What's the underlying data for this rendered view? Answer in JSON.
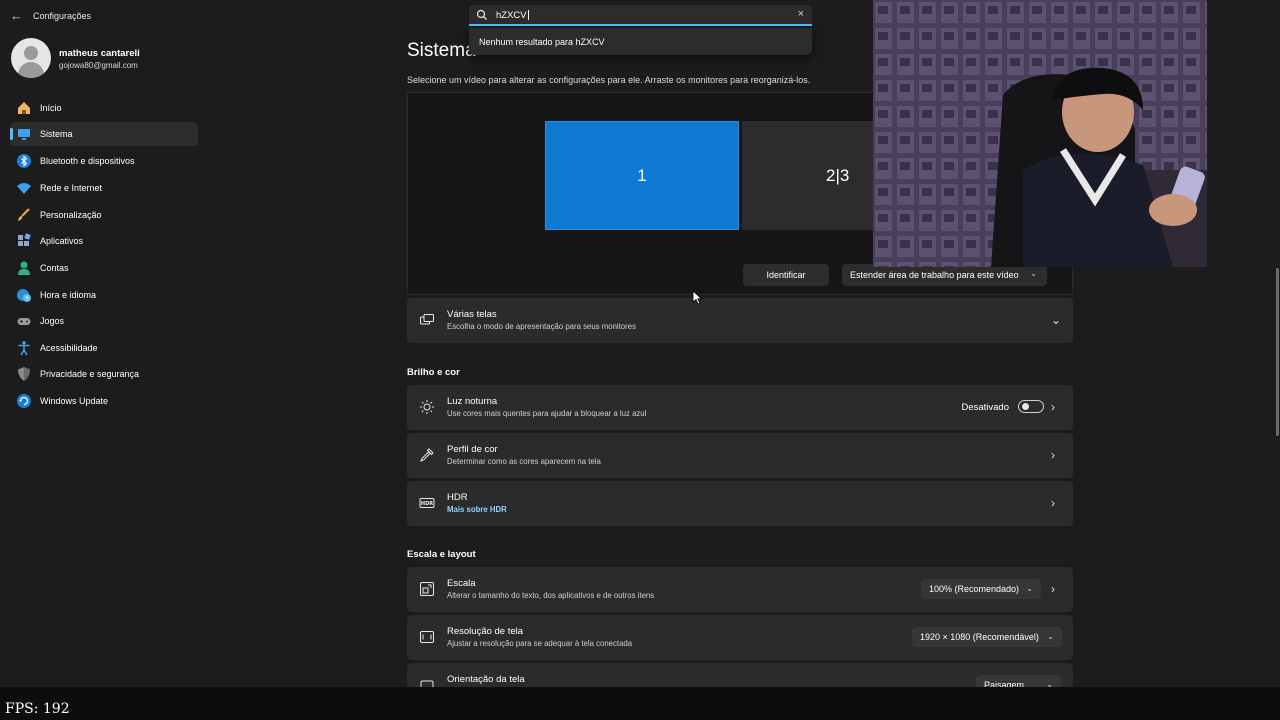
{
  "window": {
    "title": "Configurações"
  },
  "profile": {
    "name": "matheus cantareli",
    "email": "gojowa80@gmail.com"
  },
  "sidebar": {
    "items": [
      {
        "label": "Início",
        "icon": "home-icon"
      },
      {
        "label": "Sistema",
        "icon": "system-icon",
        "selected": true
      },
      {
        "label": "Bluetooth e dispositivos",
        "icon": "bluetooth-icon"
      },
      {
        "label": "Rede e Internet",
        "icon": "wifi-icon"
      },
      {
        "label": "Personalização",
        "icon": "brush-icon"
      },
      {
        "label": "Aplicativos",
        "icon": "apps-icon"
      },
      {
        "label": "Contas",
        "icon": "account-icon"
      },
      {
        "label": "Hora e idioma",
        "icon": "globe-clock-icon"
      },
      {
        "label": "Jogos",
        "icon": "gamepad-icon"
      },
      {
        "label": "Acessibilidade",
        "icon": "accessibility-icon"
      },
      {
        "label": "Privacidade e segurança",
        "icon": "shield-icon"
      },
      {
        "label": "Windows Update",
        "icon": "update-icon"
      }
    ]
  },
  "search": {
    "value": "hZXCV",
    "no_results": "Nenhum resultado para hZXCV"
  },
  "main": {
    "title": "Sistema",
    "subtitle": "Selecione um vídeo para alterar as configurações para ele. Arraste os monitores para reorganizá-los.",
    "monitors": {
      "primary": "1",
      "secondary": "2|3"
    },
    "identify_button": "Identificar",
    "extend_dropdown": "Estender área de trabalho para este vídeo",
    "multiple_displays": {
      "title": "Várias telas",
      "desc": "Escolha o modo de apresentação para seus monitores"
    },
    "section_brightness": "Brilho e cor",
    "night_light": {
      "title": "Luz noturna",
      "desc": "Use cores mais quentes para ajudar a bloquear a luz azul",
      "state": "Desativado"
    },
    "color_profile": {
      "title": "Perfil de cor",
      "desc": "Determinar como as cores aparecem na tela"
    },
    "hdr": {
      "title": "HDR",
      "link": "Mais sobre HDR"
    },
    "section_scale": "Escala e layout",
    "scale": {
      "title": "Escala",
      "desc": "Alterar o tamanho do texto, dos aplicativos e de outros itens",
      "value": "100% (Recomendado)"
    },
    "resolution": {
      "title": "Resolução de tela",
      "desc": "Ajustar a resolução para se adequar à tela conectada",
      "value": "1920 × 1080 (Recomendável)"
    },
    "orientation": {
      "title": "Orientação da tela",
      "value": "Paisagem"
    }
  },
  "overlay": {
    "fps": "FPS: 192"
  },
  "colors": {
    "accent": "#4cc2ff",
    "monitor_selected": "#0e7ad1",
    "background": "#1c1c1c",
    "card": "#2b2b2b"
  }
}
